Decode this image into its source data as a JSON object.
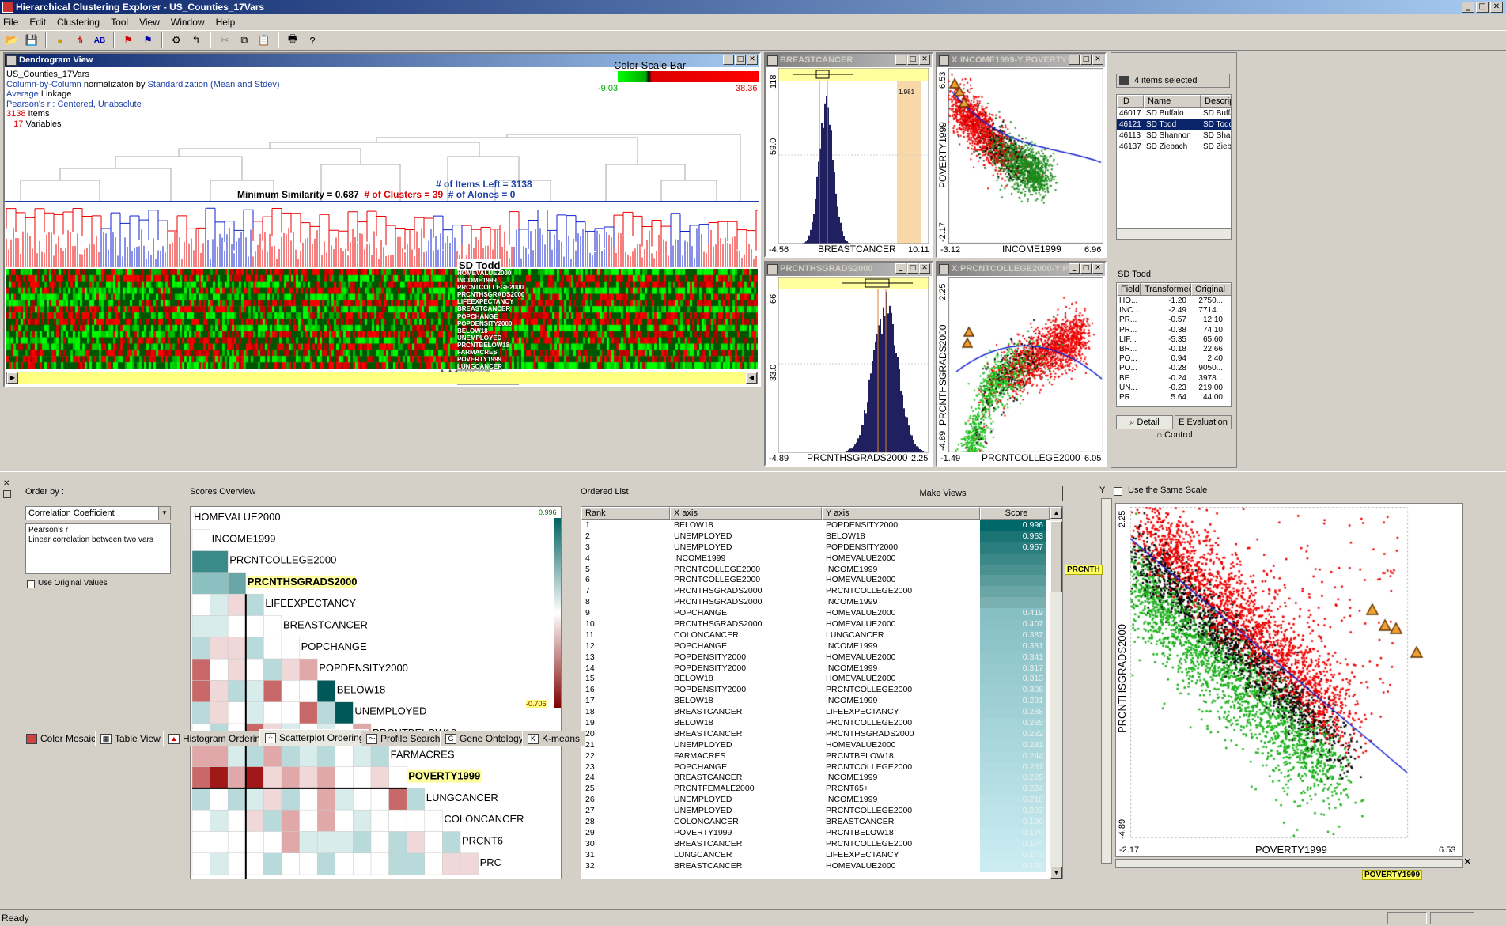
{
  "app_title": "Hierarchical Clustering Explorer - US_Counties_17Vars",
  "menu": [
    "File",
    "Edit",
    "Clustering",
    "Tool",
    "View",
    "Window",
    "Help"
  ],
  "dendrogram": {
    "title": "Dendrogram View",
    "dataset": "US_Counties_17Vars",
    "norm_a": "Column-by-Column",
    "norm_b": "normalizaton by",
    "norm_c": "Standardization (Mean and Stdev)",
    "linkage_a": "Average",
    "linkage_b": "Linkage",
    "metric": "Pearson's r : Centered, Unabsclute",
    "items_n": "3138",
    "items_l": "Items",
    "vars_n": "17",
    "vars_l": "Variables",
    "colorbar_title": "Color Scale Bar",
    "colorbar_min": "-9.03",
    "colorbar_max": "38.36",
    "items_left": "# of Items Left = 3138",
    "min_sim": "Minimum Similarity = 0.687",
    "num_clusters": "# of Clusters = 39",
    "num_alones": "# of Alones = 0",
    "selected_label": "SD Todd",
    "variables": [
      "HOMEVALUE2000",
      "INCOME1999",
      "PRCNTCOLLEGE2000",
      "PRCNTHSGRADS2000",
      "LIFEEXPECTANCY",
      "BREASTCANCER",
      "POPCHANGE",
      "POPDENSITY2000",
      "BELOW18",
      "UNEMPLOYED",
      "PRCNTBELOW18",
      "FARMACRES",
      "POVERTY1999",
      "LUNGCANCER",
      "PRCNT65+",
      "PRCNTFEMALE2000"
    ]
  },
  "hist1": {
    "title": "BREASTCANCER",
    "xlabel": "BREASTCANCER",
    "xmin": "-4.56",
    "xmax": "10.11",
    "ytop": "118",
    "ymid": "59.0",
    "ybot": "0",
    "marker": "1.981"
  },
  "hist2": {
    "title": "PRCNTHSGRADS2000",
    "xlabel": "PRCNTHSGRADS2000",
    "xmin": "-4.89",
    "xmax": "2.25",
    "ytop": "66",
    "ymid": "33.0",
    "ybot": "0"
  },
  "scatter1": {
    "title": "X:INCOME1999-Y:POVERTY1999",
    "xlabel": "INCOME1999",
    "ylabel": "POVERTY1999",
    "xmin": "-3.12",
    "xmax": "6.96",
    "ymin": "-2.17",
    "ymax": "6.53"
  },
  "scatter2": {
    "title": "X:PRCNTCOLLEGE2000-Y:PRCNT...",
    "xlabel": "PRCNTCOLLEGE2000",
    "ylabel": "PRCNTHSGRADS2000",
    "xmin": "-1.49",
    "xmax": "6.05",
    "ymin": "-4.89",
    "ymax": "2.25"
  },
  "selection": {
    "count": "4 items selected",
    "cols": [
      "ID",
      "Name",
      "Description"
    ],
    "rows": [
      [
        "46017",
        "SD Buffalo",
        "SD Buffalo"
      ],
      [
        "46121",
        "SD Todd",
        "SD Todd"
      ],
      [
        "46113",
        "SD Shannon",
        "SD Shannon"
      ],
      [
        "46137",
        "SD Ziebach",
        "SD Ziebach"
      ]
    ],
    "detail_title": "SD Todd",
    "dcols": [
      "Field",
      "Transformed",
      "Original"
    ],
    "drows": [
      [
        "HO...",
        "-1.20",
        "2750..."
      ],
      [
        "INC...",
        "-2.49",
        "7714..."
      ],
      [
        "PR...",
        "-0.57",
        "12.10"
      ],
      [
        "PR...",
        "-0.38",
        "74.10"
      ],
      [
        "LIF...",
        "-5.35",
        "65.60"
      ],
      [
        "BR...",
        "-0.18",
        "22.66"
      ],
      [
        "PO...",
        "0.94",
        "2.40"
      ],
      [
        "PO...",
        "-0.28",
        "9050..."
      ],
      [
        "BE...",
        "-0.24",
        "3978..."
      ],
      [
        "UN...",
        "-0.23",
        "219.00"
      ],
      [
        "PR...",
        "5.64",
        "44.00"
      ]
    ],
    "tab_detail": "Detail",
    "tab_eval": "Evaluation",
    "tab_control": "Control"
  },
  "order": {
    "label": "Order by :",
    "select": "Correlation Coefficient",
    "desc_title": "Pearson's r",
    "desc": "Linear correlation between two vars",
    "use_original": "Use Original Values"
  },
  "scores": {
    "title": "Scores Overview",
    "max": "0.996",
    "min": "-0.706",
    "labels": [
      "HOMEVALUE2000",
      "INCOME1999",
      "PRCNTCOLLEGE2000",
      "PRCNTHSGRADS2000",
      "LIFEEXPECTANCY",
      "BREASTCANCER",
      "POPCHANGE",
      "POPDENSITY2000",
      "BELOW18",
      "UNEMPLOYED",
      "PRCNTBELOW18",
      "FARMACRES",
      "POVERTY1999",
      "LUNGCANCER",
      "COLONCANCER",
      "PRCNT6",
      "PRC"
    ]
  },
  "ordered": {
    "title": "Ordered List",
    "make_views": "Make Views",
    "cols": [
      "Rank",
      "X axis",
      "Y axis",
      "Score"
    ],
    "rows": [
      [
        "1",
        "BELOW18",
        "POPDENSITY2000",
        "0.996"
      ],
      [
        "2",
        "UNEMPLOYED",
        "BELOW18",
        "0.963"
      ],
      [
        "3",
        "UNEMPLOYED",
        "POPDENSITY2000",
        "0.957"
      ],
      [
        "4",
        "INCOME1999",
        "HOMEVALUE2000",
        ""
      ],
      [
        "5",
        "PRCNTCOLLEGE2000",
        "INCOME1999",
        ""
      ],
      [
        "6",
        "PRCNTCOLLEGE2000",
        "HOMEVALUE2000",
        ""
      ],
      [
        "7",
        "PRCNTHSGRADS2000",
        "PRCNTCOLLEGE2000",
        ""
      ],
      [
        "8",
        "PRCNTHSGRADS2000",
        "INCOME1999",
        ""
      ],
      [
        "9",
        "POPCHANGE",
        "HOMEVALUE2000",
        "0.419"
      ],
      [
        "10",
        "PRCNTHSGRADS2000",
        "HOMEVALUE2000",
        "0.407"
      ],
      [
        "11",
        "COLONCANCER",
        "LUNGCANCER",
        "0.387"
      ],
      [
        "12",
        "POPCHANGE",
        "INCOME1999",
        "0.381"
      ],
      [
        "13",
        "POPDENSITY2000",
        "HOMEVALUE2000",
        "0.341"
      ],
      [
        "14",
        "POPDENSITY2000",
        "INCOME1999",
        "0.317"
      ],
      [
        "15",
        "BELOW18",
        "HOMEVALUE2000",
        "0.313"
      ],
      [
        "16",
        "POPDENSITY2000",
        "PRCNTCOLLEGE2000",
        "0.308"
      ],
      [
        "17",
        "BELOW18",
        "INCOME1999",
        "0.291"
      ],
      [
        "18",
        "BREASTCANCER",
        "LIFEEXPECTANCY",
        "0.288"
      ],
      [
        "19",
        "BELOW18",
        "PRCNTCOLLEGE2000",
        "0.285"
      ],
      [
        "20",
        "BREASTCANCER",
        "PRCNTHSGRADS2000",
        "0.282"
      ],
      [
        "21",
        "UNEMPLOYED",
        "HOMEVALUE2000",
        "0.281"
      ],
      [
        "22",
        "FARMACRES",
        "PRCNTBELOW18",
        "0.244"
      ],
      [
        "23",
        "POPCHANGE",
        "PRCNTCOLLEGE2000",
        "0.237"
      ],
      [
        "24",
        "BREASTCANCER",
        "INCOME1999",
        "0.229"
      ],
      [
        "25",
        "PRCNTFEMALE2000",
        "PRCNT65+",
        "0.224"
      ],
      [
        "26",
        "UNEMPLOYED",
        "INCOME1999",
        "0.210"
      ],
      [
        "27",
        "UNEMPLOYED",
        "PRCNTCOLLEGE2000",
        "0.207"
      ],
      [
        "28",
        "COLONCANCER",
        "BREASTCANCER",
        "0.199"
      ],
      [
        "29",
        "POVERTY1999",
        "PRCNTBELOW18",
        "0.179"
      ],
      [
        "30",
        "BREASTCANCER",
        "PRCNTCOLLEGE2000",
        "0.174"
      ],
      [
        "31",
        "LUNGCANCER",
        "LIFEEXPECTANCY",
        "0.173"
      ],
      [
        "32",
        "BREASTCANCER",
        "HOMEVALUE2000",
        "0.160"
      ]
    ]
  },
  "bigscatter": {
    "y_letter": "Y",
    "same_scale": "Use the Same Scale",
    "ylabel": "PRCNTHSGRADS2000",
    "xlabel": "POVERTY1999",
    "xmin": "-2.17",
    "xmax": "6.53",
    "ymin": "-4.89",
    "ymax": "2.25",
    "ytag": "PRCNTH",
    "xtag": "POVERTY1999"
  },
  "tabs": [
    "Color Mosaic",
    "Table View",
    "Histogram Ordering",
    "Scatterplot Ordering",
    "Profile Search",
    "Gene Ontology",
    "K-means"
  ],
  "status": "Ready"
}
